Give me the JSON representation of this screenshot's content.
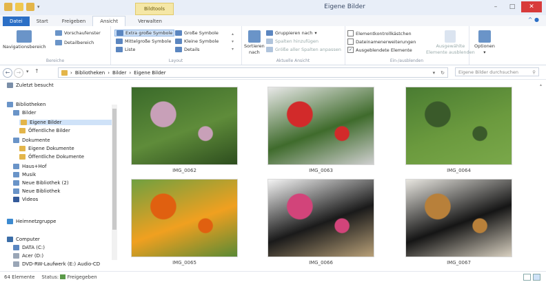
{
  "window": {
    "title": "Eigene Bilder",
    "context_tab": "Bildtools",
    "controls": [
      "–",
      "□",
      "✕"
    ]
  },
  "tabs": [
    {
      "label": "Datei"
    },
    {
      "label": "Start"
    },
    {
      "label": "Freigeben"
    },
    {
      "label": "Ansicht"
    },
    {
      "label": "Verwalten"
    }
  ],
  "ribbon": {
    "bereiche": {
      "label": "Bereiche",
      "navigation": "Navigationsbereich",
      "vorschau": "Vorschaufenster",
      "details": "Detailbereich"
    },
    "layout": {
      "label": "Layout",
      "items": [
        "Extra große Symbole",
        "Große Symbole",
        "Mittelgroße Symbole",
        "Kleine Symbole",
        "Liste",
        "Details"
      ]
    },
    "aktuelle_ansicht": {
      "label": "Aktuelle Ansicht",
      "sortieren": "Sortieren",
      "nach": "nach",
      "gruppieren": "Gruppieren nach",
      "spalten_hinzu": "Spalten hinzufügen",
      "spalten_groesse": "Größe aller Spalten anpassen"
    },
    "ein_ausblenden": {
      "label": "Ein-/ausblenden",
      "kontroll": "Elementkontrollkästchen",
      "erweiterungen": "Dateinamenerweiterungen",
      "ausgeblendet": "Ausgeblendete Elemente",
      "ausgewaehlte_1": "Ausgewählte",
      "ausgewaehlte_2": "Elemente ausblenden",
      "checks": [
        false,
        false,
        true
      ]
    },
    "optionen": "Optionen"
  },
  "address": {
    "crumbs": [
      "Bibliotheken",
      "Bilder",
      "Eigene Bilder"
    ],
    "search_placeholder": "Eigene Bilder durchsuchen"
  },
  "sidebar": {
    "items": [
      {
        "label": "Zuletzt besucht",
        "color": "#7a8ea8",
        "level": 0,
        "selected": false
      },
      {
        "label": "Bibliotheken",
        "color": "#6a94c8",
        "level": 0,
        "selected": false
      },
      {
        "label": "Bilder",
        "color": "#6a94c8",
        "level": 1,
        "selected": false
      },
      {
        "label": "Eigene Bilder",
        "color": "#e3b54a",
        "level": 2,
        "selected": true
      },
      {
        "label": "Öffentliche Bilder",
        "color": "#e3b54a",
        "level": 2,
        "selected": false
      },
      {
        "label": "Dokumente",
        "color": "#6a94c8",
        "level": 1,
        "selected": false
      },
      {
        "label": "Eigene Dokumente",
        "color": "#e3b54a",
        "level": 2,
        "selected": false
      },
      {
        "label": "Öffentliche Dokumente",
        "color": "#e3b54a",
        "level": 2,
        "selected": false
      },
      {
        "label": "Haus+Hof",
        "color": "#6a94c8",
        "level": 1,
        "selected": false
      },
      {
        "label": "Musik",
        "color": "#6a94c8",
        "level": 1,
        "selected": false
      },
      {
        "label": "Neue Bibliothek (2)",
        "color": "#6a94c8",
        "level": 1,
        "selected": false
      },
      {
        "label": "Neue Bibliothek",
        "color": "#6a94c8",
        "level": 1,
        "selected": false
      },
      {
        "label": "Videos",
        "color": "#345a9a",
        "level": 1,
        "selected": false
      },
      {
        "label": "Heimnetzgruppe",
        "color": "#3c8ad0",
        "level": 0,
        "selected": false
      },
      {
        "label": "Computer",
        "color": "#3c6ea8",
        "level": 0,
        "selected": false
      },
      {
        "label": "DATA (C:)",
        "color": "#5b86c0",
        "level": 1,
        "selected": false
      },
      {
        "label": "Acer (D:)",
        "color": "#9aa6b6",
        "level": 1,
        "selected": false
      },
      {
        "label": "DVD-RW-Laufwerk (E:) Audio-CD",
        "color": "#9aa6b6",
        "level": 1,
        "selected": false
      }
    ]
  },
  "images": [
    {
      "label": "IMG_0062",
      "colors": [
        "#3a6a2a",
        "#5f8c3a",
        "#c8a0b8",
        "#2d4d1e"
      ]
    },
    {
      "label": "IMG_0063",
      "colors": [
        "#e8e8e8",
        "#3f6b2c",
        "#d22a2a",
        "#cfcfcf"
      ]
    },
    {
      "label": "IMG_0064",
      "colors": [
        "#4a7c32",
        "#6b9a3e",
        "#3a5a2a",
        "#7aa84a"
      ]
    },
    {
      "label": "IMG_0065",
      "colors": [
        "#6fa040",
        "#f0a020",
        "#e06010",
        "#5a8a35"
      ]
    },
    {
      "label": "IMG_0066",
      "colors": [
        "#f4f4f4",
        "#1a1a1a",
        "#d2447a",
        "#b8a078"
      ]
    },
    {
      "label": "IMG_0067",
      "colors": [
        "#e8e6e0",
        "#151515",
        "#b8803a",
        "#d8d0c0"
      ]
    }
  ],
  "status": {
    "count": "64 Elemente",
    "state_label": "Status:",
    "state_value": "Freigegeben"
  }
}
